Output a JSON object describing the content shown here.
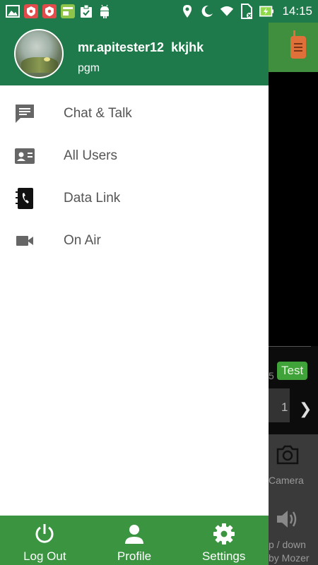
{
  "status_bar": {
    "time": "14:15",
    "icons": [
      "gallery-icon",
      "vpn-shield-icon",
      "vpn-shield-icon",
      "app-icon",
      "clipboard-check-icon",
      "android-icon",
      "location-icon",
      "moon-icon",
      "wifi-icon",
      "sim-off-icon",
      "battery-charging-icon"
    ]
  },
  "drawer": {
    "user_name": "mr.apitester12  kkjhk",
    "user_sub": "pgm",
    "items": [
      {
        "label": "Chat & Talk",
        "icon": "chat-icon"
      },
      {
        "label": "All Users",
        "icon": "contacts-card-icon"
      },
      {
        "label": "Data Link",
        "icon": "phone-book-icon"
      },
      {
        "label": "On Air",
        "icon": "videocam-icon"
      }
    ],
    "footer": [
      {
        "label": "Log Out",
        "icon": "power-icon"
      },
      {
        "label": "Profile",
        "icon": "person-icon"
      },
      {
        "label": "Settings",
        "icon": "gear-icon"
      }
    ]
  },
  "background_app": {
    "badge_fragment": "5",
    "test_label": "Test",
    "pager_fragment": "1",
    "camera_label": "Camera",
    "volume_label": "p / down",
    "credit": "by Mozer"
  },
  "colors": {
    "header_green": "#1e7a4a",
    "footer_green": "#3a9440",
    "menu_text": "#555555"
  }
}
